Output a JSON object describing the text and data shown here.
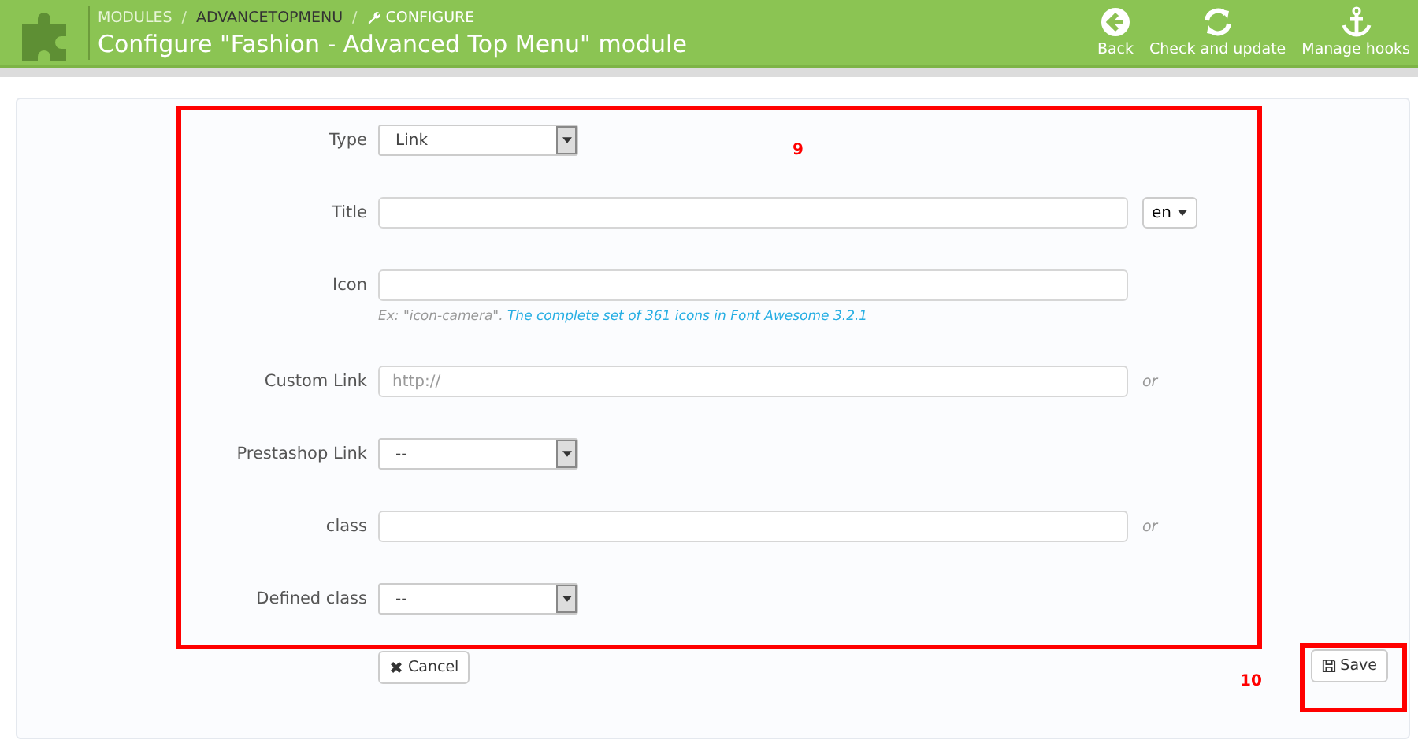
{
  "header": {
    "separator": "/",
    "breadcrumb": [
      {
        "label": "MODULES",
        "kind": "plain"
      },
      {
        "label": "ADVANCETOPMENU",
        "kind": "plain"
      },
      {
        "label": "CONFIGURE",
        "kind": "current"
      }
    ],
    "title": "Configure \"Fashion - Advanced Top Menu\" module",
    "toolbar": [
      {
        "label": "Back",
        "kind": "back"
      },
      {
        "label": "Check and update",
        "kind": "refresh"
      },
      {
        "label": "Manage hooks",
        "kind": "anchor"
      }
    ]
  },
  "form": {
    "fields": [
      {
        "label": "Type",
        "kind": "select",
        "value": "Link"
      },
      {
        "label": "Title",
        "kind": "text",
        "language": "en"
      },
      {
        "label": "Icon",
        "kind": "text",
        "help": "Ex: \"icon-camera\".",
        "help_link": "The complete set of 361 icons in Font Awesome 3.2.1"
      },
      {
        "label": "Custom Link",
        "kind": "text",
        "placeholder": "http://",
        "suffix": "or"
      },
      {
        "label": "Prestashop Link",
        "kind": "select",
        "value": "--"
      },
      {
        "label": "class",
        "kind": "text",
        "suffix": "or"
      },
      {
        "label": "Defined class",
        "kind": "select",
        "value": "--"
      }
    ],
    "cancel": "Cancel",
    "save": "Save"
  },
  "annotations": [
    {
      "label": "9"
    },
    {
      "label": "10"
    }
  ]
}
